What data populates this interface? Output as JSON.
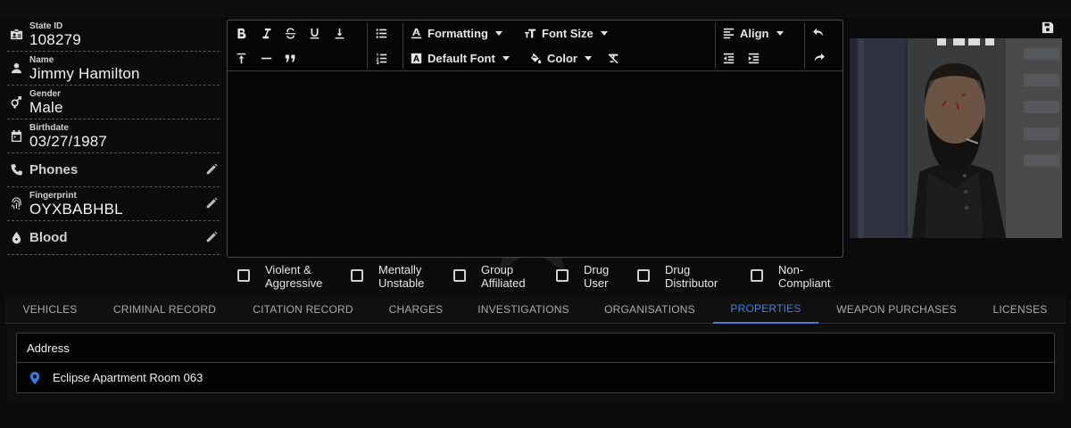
{
  "profile": {
    "state_id": {
      "label": "State ID",
      "value": "108279"
    },
    "name": {
      "label": "Name",
      "value": "Jimmy Hamilton"
    },
    "gender": {
      "label": "Gender",
      "value": "Male"
    },
    "birthdate": {
      "label": "Birthdate",
      "value": "03/27/1987"
    },
    "phones": {
      "label": "Phones"
    },
    "fingerprint": {
      "label": "Fingerprint",
      "value": "OYXBABHBL"
    },
    "blood": {
      "label": "Blood"
    }
  },
  "editor": {
    "formatting_label": "Formatting",
    "font_size_label": "Font Size",
    "font_label": "Default Font",
    "color_label": "Color",
    "align_label": "Align"
  },
  "flags": [
    {
      "line1": "Violent &",
      "line2": "Aggressive"
    },
    {
      "line1": "Mentally",
      "line2": "Unstable"
    },
    {
      "line1": "Group",
      "line2": "Affiliated"
    },
    {
      "line1": "Drug",
      "line2": "User"
    },
    {
      "line1": "Drug",
      "line2": "Distributor"
    },
    {
      "line1": "Non-",
      "line2": "Compliant"
    }
  ],
  "tabs": [
    {
      "label": "VEHICLES"
    },
    {
      "label": "CRIMINAL RECORD"
    },
    {
      "label": "CITATION RECORD"
    },
    {
      "label": "CHARGES"
    },
    {
      "label": "INVESTIGATIONS"
    },
    {
      "label": "ORGANISATIONS"
    },
    {
      "label": "PROPERTIES"
    },
    {
      "label": "WEAPON PURCHASES"
    },
    {
      "label": "LICENSES"
    }
  ],
  "active_tab": "PROPERTIES",
  "properties": {
    "header": "Address",
    "rows": [
      {
        "address": "Eclipse Apartment Room 063"
      }
    ]
  },
  "colors": {
    "accent": "#3f7fd6",
    "pin": "#2f7de1",
    "background": "#0b0b0b"
  }
}
